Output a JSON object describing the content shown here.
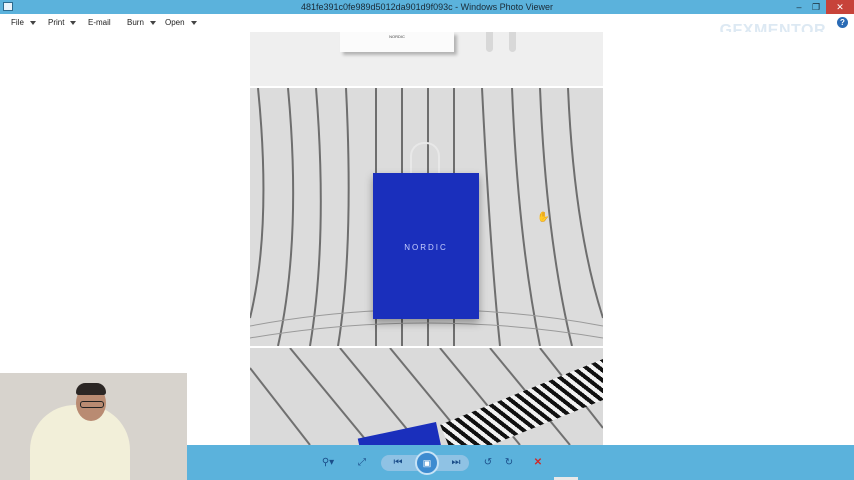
{
  "window": {
    "title": "481fe391c0fe989d5012da901d9f093c - Windows Photo Viewer",
    "controls": {
      "minimize": "–",
      "restore": "❐",
      "close": "✕"
    }
  },
  "menu": {
    "items": [
      {
        "label": "File",
        "has_dropdown": true
      },
      {
        "label": "Print",
        "has_dropdown": true
      },
      {
        "label": "E-mail",
        "has_dropdown": false
      },
      {
        "label": "Burn",
        "has_dropdown": true
      },
      {
        "label": "Open",
        "has_dropdown": true
      }
    ],
    "help_icon": "?"
  },
  "watermark": "GFXMENTOR",
  "image": {
    "card_text": "NORDIC",
    "bag_brand": "NORDIC",
    "hand_cursor": "✋"
  },
  "toolbar": {
    "zoom_icon": "⚲▾",
    "fit_icon": "⤢",
    "prev_icon": "⏮",
    "slideshow_icon": "▣",
    "next_icon": "⏭",
    "rotate_left_icon": "↺",
    "rotate_right_icon": "↻",
    "delete_icon": "✕"
  },
  "colors": {
    "chrome": "#5bb2dc",
    "bag_blue": "#1a2fbc",
    "close_red": "#c7433a"
  }
}
